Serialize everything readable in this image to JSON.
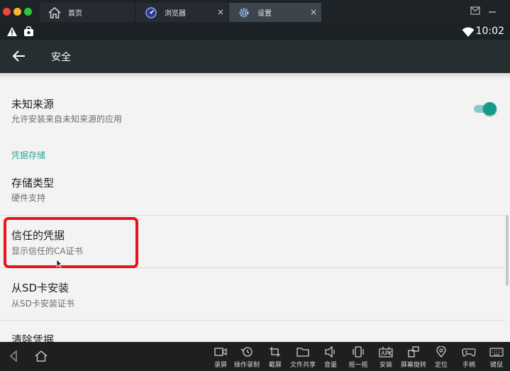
{
  "tabs": {
    "home": {
      "label": "首页"
    },
    "browser": {
      "label": "浏览器"
    },
    "settings": {
      "label": "设置"
    },
    "close_glyph": "×"
  },
  "statusbar": {
    "time": "10:02"
  },
  "appbar": {
    "title": "安全"
  },
  "settings_items": {
    "unknown_sources": {
      "title": "未知来源",
      "subtitle": "允许安装来自未知来源的应用",
      "enabled": true
    },
    "category_credential_storage": "凭据存储",
    "storage_type": {
      "title": "存储类型",
      "subtitle": "硬件支持"
    },
    "trusted_credentials": {
      "title": "信任的凭据",
      "subtitle": "显示信任的CA证书"
    },
    "install_from_sd": {
      "title": "从SD卡安装",
      "subtitle": "从SD卡安装证书"
    },
    "clear_credentials": {
      "title": "清除凭据"
    }
  },
  "toolbar": {
    "record": "录屏",
    "macro": "操作录制",
    "screenshot": "截屏",
    "file_share": "文件共享",
    "volume": "音量",
    "shake": "摇一摇",
    "install": "安装",
    "rotate": "屏幕旋转",
    "location": "定位",
    "gamepad": "手柄",
    "keyboard": "键鼠"
  },
  "colors": {
    "accent": "#2aa79a",
    "toggle_thumb": "#159a8c",
    "highlight": "#e8131c"
  }
}
